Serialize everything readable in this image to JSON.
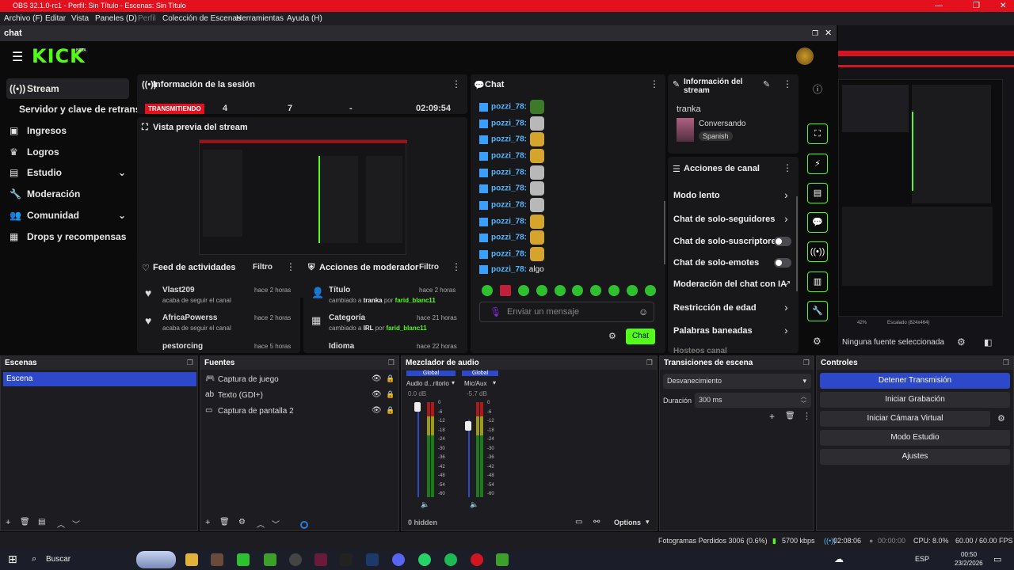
{
  "window": {
    "title": "OBS 32.1.0-rc1 - Perfil: Sin Título - Escenas: Sin Título"
  },
  "menu": [
    "Archivo (F)",
    "Editar",
    "Vista",
    "Paneles (D)",
    "Perfil",
    "Colección de Escenas",
    "Herramientas",
    "Ayuda (H)"
  ],
  "dock": {
    "title": "chat"
  },
  "kick": {
    "logo": "KICK",
    "beta": "BETA",
    "nav": [
      {
        "label": "Stream",
        "icon": "broadcast-icon"
      },
      {
        "label": "Servidor y clave de retransmisión",
        "icon": ""
      },
      {
        "label": "Ingresos",
        "icon": "wallet-icon"
      },
      {
        "label": "Logros",
        "icon": "trophy-icon"
      },
      {
        "label": "Estudio",
        "icon": "film-icon"
      },
      {
        "label": "Moderación",
        "icon": "wrench-icon"
      },
      {
        "label": "Comunidad",
        "icon": "people-icon"
      },
      {
        "label": "Drops y recompensas",
        "icon": "gift-icon"
      }
    ],
    "session": {
      "title": "Información de la sesión",
      "status": "TRANSMITIENDO",
      "viewers": "4",
      "followers": "7",
      "subs": "-",
      "time": "02:09:54"
    },
    "preview": {
      "title": "Vista previa del stream"
    },
    "activity": {
      "title": "Feed de actividades",
      "filter": "Filtro",
      "items": [
        {
          "user": "Vlast209",
          "text": "acaba de seguir el canal",
          "time": "hace 2 horas"
        },
        {
          "user": "AfricaPowerss",
          "text": "acaba de seguir el canal",
          "time": "hace 2 horas"
        },
        {
          "user": "pestorcing",
          "text": "",
          "time": "hace 5 horas"
        }
      ]
    },
    "modactions": {
      "title": "Acciones de moderador",
      "filter": "Filtro",
      "items": [
        {
          "title": "Título",
          "time": "hace 2 horas",
          "pre": "cambiado a ",
          "value": "tranka",
          "mid": " por ",
          "by": "farid_blanc11"
        },
        {
          "title": "Categoría",
          "time": "hace 21 horas",
          "pre": "cambiado a ",
          "value": "IRL",
          "mid": " por ",
          "by": "farid_blanc11"
        },
        {
          "title": "Idioma",
          "time": "hace 22 horas",
          "pre": "",
          "value": "",
          "mid": "",
          "by": ""
        }
      ]
    },
    "chat": {
      "title": "Chat",
      "user": "pozzi_78:",
      "last_msg": "algo",
      "placeholder": "Enviar un mensaje",
      "send": "Chat"
    },
    "streaminfo": {
      "title": "Información del stream",
      "stream_title": "tranka",
      "category": "Conversando",
      "language": "Spanish"
    },
    "channelactions": {
      "title": "Acciones de canal",
      "items": [
        "Modo lento",
        "Chat de solo-seguidores",
        "Chat de solo-suscriptores",
        "Chat de solo-emotes",
        "Moderación del chat con IA",
        "Restricción de edad",
        "Palabras baneadas",
        "Hosteos canal"
      ]
    }
  },
  "right_preview": {
    "zoom": "42%",
    "scale": "Escalado (824x464)",
    "no_source": "Ninguna fuente seleccionada"
  },
  "scenes": {
    "title": "Escenas",
    "items": [
      "Escena"
    ]
  },
  "sources": {
    "title": "Fuentes",
    "items": [
      "Captura de juego",
      "Texto (GDI+)",
      "Captura de pantalla 2"
    ]
  },
  "mixer": {
    "title": "Mezclador de audio",
    "channels": [
      {
        "tag": "Global",
        "name": "Audio d...ritorio",
        "db": "0.0 dB"
      },
      {
        "tag": "Global",
        "name": "Mic/Aux",
        "db": "-5.7 dB"
      }
    ],
    "ticks": [
      "0",
      "-6",
      "-12",
      "-18",
      "-24",
      "-30",
      "-36",
      "-42",
      "-48",
      "-54",
      "-60"
    ],
    "hidden": "0 hidden",
    "options": "Options"
  },
  "transitions": {
    "title": "Transiciones de escena",
    "selected": "Desvanecimiento",
    "duration_label": "Duración",
    "duration": "300 ms"
  },
  "controls": {
    "title": "Controles",
    "buttons": [
      "Detener Transmisión",
      "Iniciar Grabación",
      "Iniciar Cámara Virtual",
      "Modo Estudio",
      "Ajustes"
    ]
  },
  "status": {
    "frames": "Fotogramas Perdidos 3006 (0.6%)",
    "bitrate": "5700 kbps",
    "stream_time": "02:08:06",
    "rec_time": "00:00:00",
    "cpu": "CPU: 8.0%",
    "fps": "60.00 / 60.00 FPS"
  },
  "taskbar": {
    "search": "Buscar",
    "lang": "ESP",
    "time": "00:50",
    "date": "23/2/2026"
  },
  "colors": {
    "kick_green": "#53fc18",
    "obs_red": "#e3101d",
    "obs_blue": "#2d48c9"
  }
}
